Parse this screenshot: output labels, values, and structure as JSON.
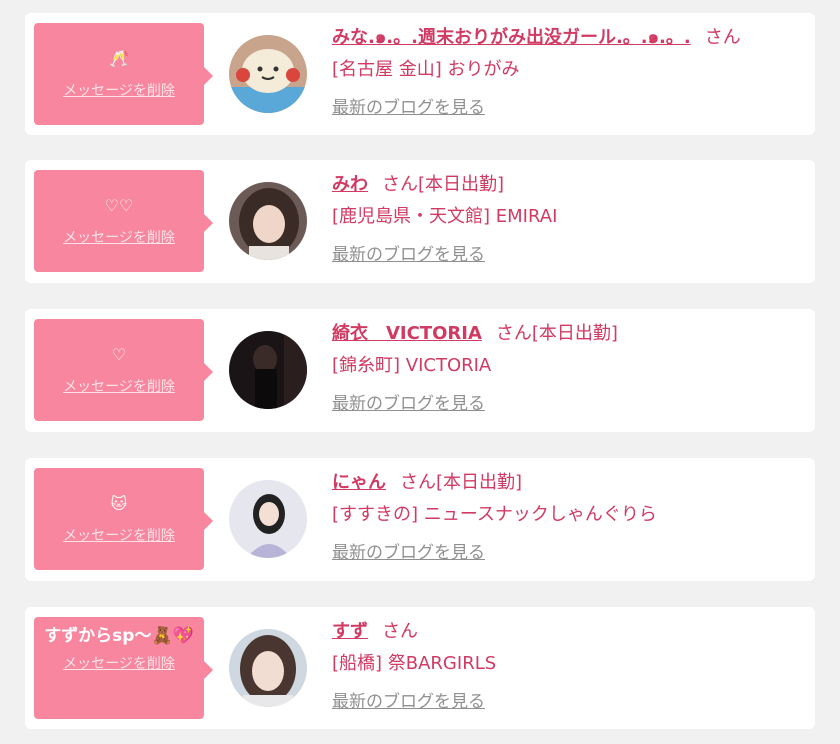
{
  "items": [
    {
      "message": "🥂",
      "delete_label": "メッセージを削除",
      "name": "みな.๑.。.週末おりがみ出没ガール.。.๑.。.",
      "san": "さん",
      "status": "",
      "shop": "[名古屋 金山] おりがみ",
      "blog_label": "最新のブログを見る"
    },
    {
      "message": "♡♡",
      "delete_label": "メッセージを削除",
      "name": "みわ",
      "san": "さん",
      "status": "[本日出勤]",
      "shop": "[鹿児島県・天文館] EMIRAI",
      "blog_label": "最新のブログを見る"
    },
    {
      "message": "♡",
      "delete_label": "メッセージを削除",
      "name": "綺衣　VICTORIA",
      "san": "さん",
      "status": "[本日出勤]",
      "shop": "[錦糸町] VICTORIA",
      "blog_label": "最新のブログを見る"
    },
    {
      "message": "🐱",
      "delete_label": "メッセージを削除",
      "name": "にゃん",
      "san": "さん",
      "status": "[本日出勤]",
      "shop": "[すすきの] ニュースナックしゃんぐりら",
      "blog_label": "最新のブログを見る"
    },
    {
      "message": "すずからsp〜🧸💖",
      "delete_label": "メッセージを削除",
      "name": "すず",
      "san": "さん",
      "status": "",
      "shop": "[船橋] 祭BARGIRLS",
      "blog_label": "最新のブログを見る"
    }
  ],
  "colors": {
    "bubble": "#f7869e",
    "accent": "#d13a63",
    "link_gray": "#909090",
    "background": "#f1f1f1"
  }
}
